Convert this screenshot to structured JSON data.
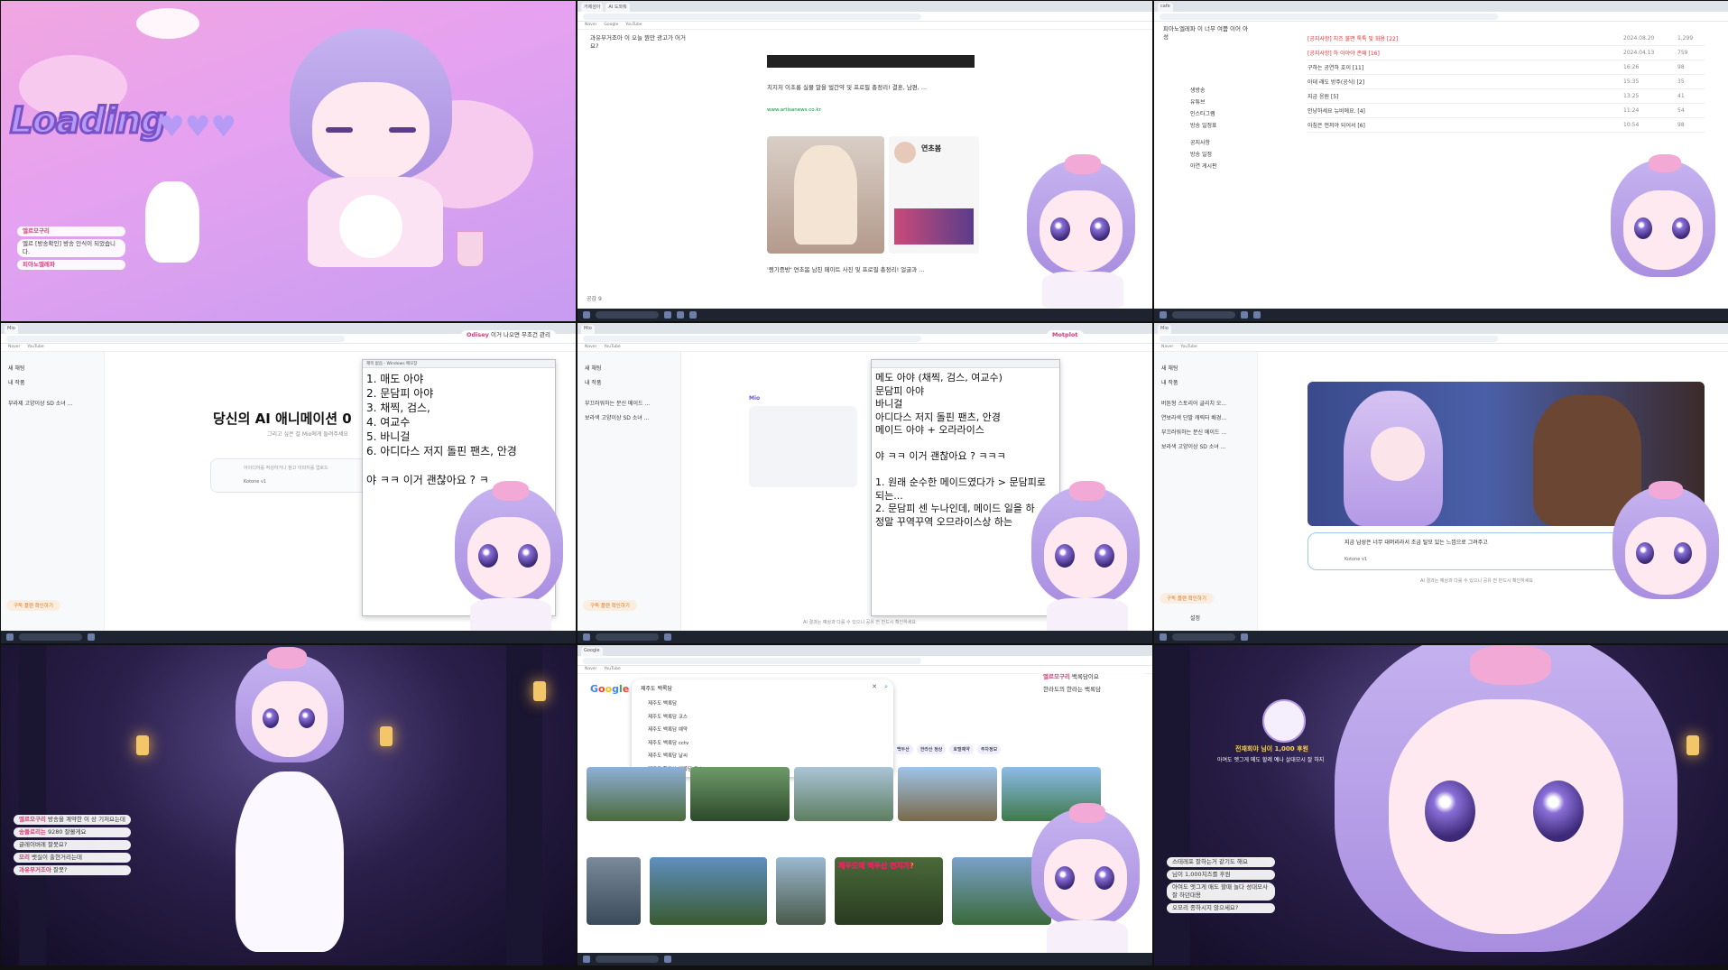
{
  "tile1": {
    "loading_title": "Loading",
    "chat": [
      {
        "name": "엘르모구리",
        "text": ""
      },
      {
        "name": "",
        "text": "엘르 [방송확인] 방송 인식이 되었습니다."
      },
      {
        "name": "피아노엘레파",
        "text": ""
      }
    ]
  },
  "tile2": {
    "tabs": [
      "거제섬아",
      "AI 도와줘"
    ],
    "chat_top": "과유부거조아 이 오늘 뭔만 광고가 어거요?",
    "headline_1": "치지처 이초롱 실물 말을 벌간약 및 프로필 총정리! 결혼, 남편, ...",
    "source_1": "www.artisanews.co.kr",
    "profile_name": "연초봄",
    "caption_1": "'쩡기증방' 연초봄 남친 페이트 사진 및 프로필 총정리! 얼굴과 ...",
    "footer": "공감 9"
  },
  "tile3": {
    "top_chat": "피아노엘레파 이 너무 여쭙 이어 아 성",
    "posts": [
      {
        "title": "[공지사항] 치즈 불면 톡톡 및 화용 [22]",
        "date": "2024.08.20",
        "views": "1,299"
      },
      {
        "title": "[공지사항] 하 아야야 존재 [16]",
        "date": "2024.04.13",
        "views": "759"
      },
      {
        "title": "구하는 공연하 호이 [11]",
        "date": "16:26",
        "views": "98"
      },
      {
        "title": "아데 래도 방주(공식) [2]",
        "date": "15:35",
        "views": "35"
      },
      {
        "title": "지금 응원 [5]",
        "date": "13:25",
        "views": "41"
      },
      {
        "title": "안냥하세요 뉴비에요. [4]",
        "date": "11:24",
        "views": "54"
      },
      {
        "title": "아침은 먼저야 되어서 [6]",
        "date": "10:54",
        "views": "98"
      }
    ],
    "menu": [
      "생방송",
      "유튜브",
      "인스타그램",
      "방송 일정표",
      "공지사항",
      "방송 일정",
      "아연 게시판"
    ]
  },
  "tile4": {
    "sidebar": [
      "새 채팅",
      "내 작품",
      "부라제 고양이상 SD 소녀 ..."
    ],
    "heading": "당신의 AI 애니메이션 0",
    "sub": "그리고 싶은 걸 Mio에게 들려주세요",
    "notepad_title": "제목 없음 - Windows 메모장",
    "notepad_text": "1. 매도 아야\n2. 문담피 아야\n3. 채찍, 검스,\n4. 여교수\n5. 바니걸\n6. 아디다스 저지 돌핀 팬츠, 안경\n\n야 ㅋㅋ 이거 괜찮아요 ? ㅋ",
    "input_placeholder": "아이디어를 작성하거나 참고 이미지를 업로드",
    "model": "Kotone v1",
    "footer_btn": "구독 플랜 확인하기",
    "chat_name": "Odisey",
    "chat_text": "이거 나오면 무조건 관리"
  },
  "tile5": {
    "sidebar": [
      "새 채팅",
      "내 작품",
      "부끄러워하는 분신 메이드 ...",
      "보라색 고양이상 SD 소녀 ..."
    ],
    "assistant_name": "Mio",
    "notepad_text": "메도 아야 (채찍, 검스, 여교수)\n문담피 아야\n바니걸\n아디다스 저지 돌핀 팬츠, 안경\n메이드 아야 + 오라라이스\n\n야 ㅋㅋ 이거 괜찮아요 ? ㅋㅋㅋ\n\n1. 원래 순수한 메이드였다가 > 문담피로\n되는...\n2. 문담피 센 누나인데, 메이드 일을 하\n정말 꾸역꾸역 오므라이스상 하는",
    "chat_name": "Motplot",
    "footer": "AI 결과는 예상과 다를 수 있으니 공유 전 반드시 확인하세요",
    "footer_btn": "구독 플랜 확인하기"
  },
  "tile6": {
    "sidebar": [
      "새 채팅",
      "내 작품",
      "버튼형 스토리어 글리치 오...",
      "연보라색 단발 캐릭터 배경...",
      "부끄러워하는 분신 메이드 ...",
      "보라색 고양이상 SD 소녀 ..."
    ],
    "input_text": "지금 남성은 너무 대머리라서 조금 탈모 있는 느낌으로 그려주고",
    "model": "Kotone v1",
    "footer": "AI 결과는 예상과 다를 수 있으니 공유 전 반드시 확인하세요",
    "footer_btn": "구독 플랜 확인하기",
    "settings": "설정"
  },
  "tile7": {
    "chat": [
      {
        "name": "엘르모구리",
        "text": "방송을 계약한 이 상 기저요는데"
      },
      {
        "name": "송플로리는",
        "text": "9280 잘볼게요"
      },
      {
        "name": "",
        "text": "글레이버레 잘못요?"
      },
      {
        "name": "모리",
        "text": "뱃실이 출현거리는데"
      },
      {
        "name": "과유부거조아",
        "text": "잘못?"
      }
    ]
  },
  "tile8": {
    "search_value": "제주도 백록담",
    "suggestions": [
      "제주도 백록담",
      "제주도 백록담 코스",
      "제주도 백록담 예약",
      "제주도 백록담 cctv",
      "제주도 백록담 날씨",
      "제주도 한라산 백록담 코스"
    ],
    "overlay_text": "제주도에 백두산 천지가?",
    "chat_name": "엘르모구리",
    "chat_text": "백록담이요",
    "chat_2": "한라도의 한라는 백록담",
    "chip_labels": [
      "백두산",
      "한라산 정상",
      "호텔예약",
      "주차정보"
    ]
  },
  "tile9": {
    "donation": "전재회야 님이 1,000 후원",
    "donation_msg": "아여도 엣그게 메도 할레 예나 살대모시 잘 하지",
    "chat": [
      {
        "name": "",
        "text": "스테레포 잘하는거 같기도 해요"
      },
      {
        "name": "",
        "text": "님이 1,000치즈를 후원"
      },
      {
        "name": "",
        "text": "아여도 엣그게 매도 할때 놀다 성대모사 잘 하던대용"
      },
      {
        "name": "",
        "text": "오모리 종하시지 않으세요?"
      }
    ]
  },
  "colors": {
    "accent_pink": "#f2a9d6",
    "hair_lavender": "#b9a2ec",
    "loading_purple": "#7a52c7",
    "chat_name": "#d23d7a"
  }
}
